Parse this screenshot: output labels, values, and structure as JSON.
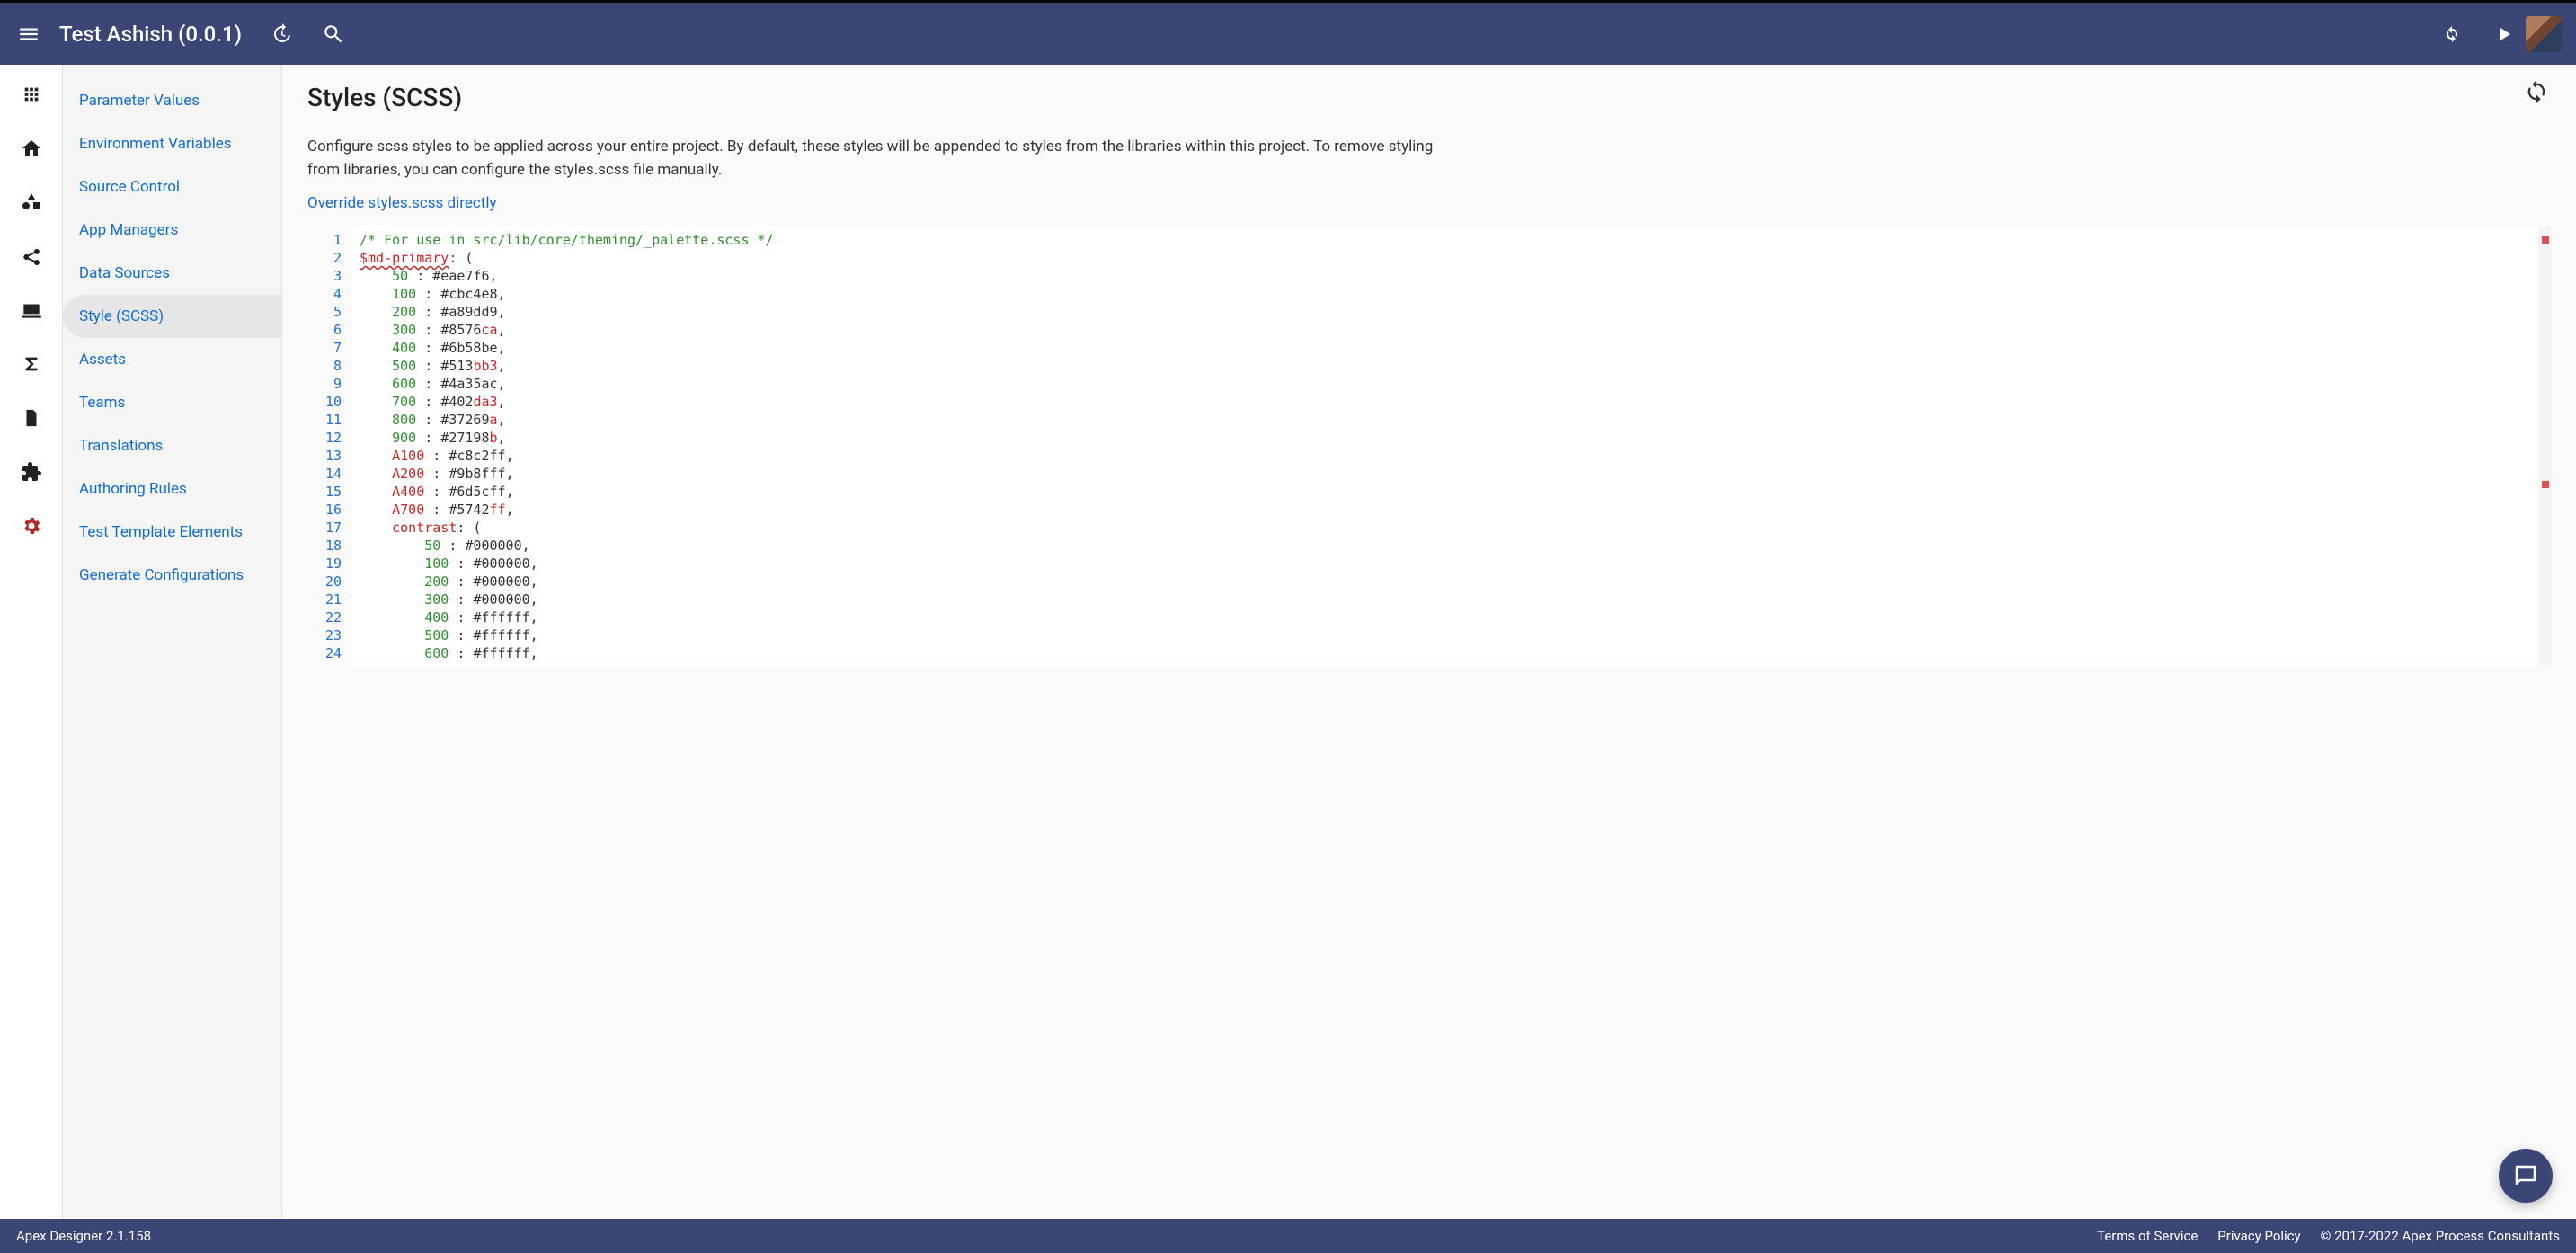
{
  "header": {
    "title": "Test Ashish (0.0.1)"
  },
  "rail": [
    {
      "name": "apps-icon"
    },
    {
      "name": "home-icon"
    },
    {
      "name": "shapes-icon"
    },
    {
      "name": "share-icon"
    },
    {
      "name": "laptop-icon"
    },
    {
      "name": "sigma-icon"
    },
    {
      "name": "file-icon"
    },
    {
      "name": "extension-icon"
    },
    {
      "name": "settings-icon"
    }
  ],
  "sidemenu": {
    "items": [
      {
        "label": "Parameter Values"
      },
      {
        "label": "Environment Variables"
      },
      {
        "label": "Source Control"
      },
      {
        "label": "App Managers"
      },
      {
        "label": "Data Sources"
      },
      {
        "label": "Style (SCSS)",
        "active": true
      },
      {
        "label": "Assets"
      },
      {
        "label": "Teams"
      },
      {
        "label": "Translations"
      },
      {
        "label": "Authoring Rules"
      },
      {
        "label": "Test Template Elements"
      },
      {
        "label": "Generate Configurations"
      }
    ]
  },
  "content": {
    "title": "Styles (SCSS)",
    "desc": "Configure scss styles to be applied across your entire project. By default, these styles will be appended to styles from the libraries within this project. To remove styling from libraries, you can configure the styles.scss file manually.",
    "link": "Override styles.scss directly"
  },
  "code": {
    "lines": [
      {
        "n": 1,
        "segs": [
          {
            "t": "/* For use in src/lib/core/theming/_palette.scss */",
            "c": "c-comment"
          }
        ]
      },
      {
        "n": 2,
        "segs": [
          {
            "t": "$md-primary",
            "c": "c-var underline-red"
          },
          {
            "t": ":",
            "c": "c-var"
          },
          {
            "t": " (",
            "c": "c-text"
          }
        ]
      },
      {
        "n": 3,
        "segs": [
          {
            "t": "    50 ",
            "c": "c-num"
          },
          {
            "t": ": ",
            "c": "c-text"
          },
          {
            "t": "#eae7f6",
            "c": "c-hex"
          },
          {
            "t": ",",
            "c": "c-text"
          }
        ]
      },
      {
        "n": 4,
        "segs": [
          {
            "t": "    100 ",
            "c": "c-num"
          },
          {
            "t": ": ",
            "c": "c-text"
          },
          {
            "t": "#cbc4e8",
            "c": "c-hex"
          },
          {
            "t": ",",
            "c": "c-text"
          }
        ]
      },
      {
        "n": 5,
        "segs": [
          {
            "t": "    200 ",
            "c": "c-num"
          },
          {
            "t": ": ",
            "c": "c-text"
          },
          {
            "t": "#a89dd9",
            "c": "c-hex"
          },
          {
            "t": ",",
            "c": "c-text"
          }
        ]
      },
      {
        "n": 6,
        "segs": [
          {
            "t": "    300 ",
            "c": "c-num"
          },
          {
            "t": ": ",
            "c": "c-text"
          },
          {
            "t": "#8576",
            "c": "c-hex"
          },
          {
            "t": "ca",
            "c": "c-hexr"
          },
          {
            "t": ",",
            "c": "c-text"
          }
        ]
      },
      {
        "n": 7,
        "segs": [
          {
            "t": "    400 ",
            "c": "c-num"
          },
          {
            "t": ": ",
            "c": "c-text"
          },
          {
            "t": "#6b58be",
            "c": "c-hex"
          },
          {
            "t": ",",
            "c": "c-text"
          }
        ]
      },
      {
        "n": 8,
        "segs": [
          {
            "t": "    500 ",
            "c": "c-num"
          },
          {
            "t": ": ",
            "c": "c-text"
          },
          {
            "t": "#513",
            "c": "c-hex"
          },
          {
            "t": "bb3",
            "c": "c-hexr"
          },
          {
            "t": ",",
            "c": "c-text"
          }
        ]
      },
      {
        "n": 9,
        "segs": [
          {
            "t": "    600 ",
            "c": "c-num"
          },
          {
            "t": ": ",
            "c": "c-text"
          },
          {
            "t": "#4a35ac",
            "c": "c-hex"
          },
          {
            "t": ",",
            "c": "c-text"
          }
        ]
      },
      {
        "n": 10,
        "segs": [
          {
            "t": "    700 ",
            "c": "c-num"
          },
          {
            "t": ": ",
            "c": "c-text"
          },
          {
            "t": "#402",
            "c": "c-hex"
          },
          {
            "t": "da3",
            "c": "c-hexr"
          },
          {
            "t": ",",
            "c": "c-text"
          }
        ]
      },
      {
        "n": 11,
        "segs": [
          {
            "t": "    800 ",
            "c": "c-num"
          },
          {
            "t": ": ",
            "c": "c-text"
          },
          {
            "t": "#37269",
            "c": "c-hex"
          },
          {
            "t": "a",
            "c": "c-hexr"
          },
          {
            "t": ",",
            "c": "c-text"
          }
        ]
      },
      {
        "n": 12,
        "segs": [
          {
            "t": "    900 ",
            "c": "c-num"
          },
          {
            "t": ": ",
            "c": "c-text"
          },
          {
            "t": "#27198",
            "c": "c-hex"
          },
          {
            "t": "b",
            "c": "c-hexr"
          },
          {
            "t": ",",
            "c": "c-text"
          }
        ]
      },
      {
        "n": 13,
        "segs": [
          {
            "t": "    A100 ",
            "c": "c-key"
          },
          {
            "t": ": ",
            "c": "c-text"
          },
          {
            "t": "#c8c2ff",
            "c": "c-hex"
          },
          {
            "t": ",",
            "c": "c-text"
          }
        ]
      },
      {
        "n": 14,
        "segs": [
          {
            "t": "    A200 ",
            "c": "c-key"
          },
          {
            "t": ": ",
            "c": "c-text"
          },
          {
            "t": "#9b8fff",
            "c": "c-hex"
          },
          {
            "t": ",",
            "c": "c-text"
          }
        ]
      },
      {
        "n": 15,
        "segs": [
          {
            "t": "    A400 ",
            "c": "c-key"
          },
          {
            "t": ": ",
            "c": "c-text"
          },
          {
            "t": "#6d5cff",
            "c": "c-hex"
          },
          {
            "t": ",",
            "c": "c-text"
          }
        ]
      },
      {
        "n": 16,
        "segs": [
          {
            "t": "    A700 ",
            "c": "c-key"
          },
          {
            "t": ": ",
            "c": "c-text"
          },
          {
            "t": "#5742",
            "c": "c-hex"
          },
          {
            "t": "ff",
            "c": "c-hexr"
          },
          {
            "t": ",",
            "c": "c-text"
          }
        ]
      },
      {
        "n": 17,
        "segs": [
          {
            "t": "    contrast",
            "c": "c-key"
          },
          {
            "t": ": (",
            "c": "c-text"
          }
        ]
      },
      {
        "n": 18,
        "segs": [
          {
            "t": "        50 ",
            "c": "c-num"
          },
          {
            "t": ": ",
            "c": "c-text"
          },
          {
            "t": "#000000",
            "c": "c-hex"
          },
          {
            "t": ",",
            "c": "c-text"
          }
        ]
      },
      {
        "n": 19,
        "segs": [
          {
            "t": "        100 ",
            "c": "c-num"
          },
          {
            "t": ": ",
            "c": "c-text"
          },
          {
            "t": "#000000",
            "c": "c-hex"
          },
          {
            "t": ",",
            "c": "c-text"
          }
        ]
      },
      {
        "n": 20,
        "segs": [
          {
            "t": "        200 ",
            "c": "c-num"
          },
          {
            "t": ": ",
            "c": "c-text"
          },
          {
            "t": "#000000",
            "c": "c-hex"
          },
          {
            "t": ",",
            "c": "c-text"
          }
        ]
      },
      {
        "n": 21,
        "segs": [
          {
            "t": "        300 ",
            "c": "c-num"
          },
          {
            "t": ": ",
            "c": "c-text"
          },
          {
            "t": "#000000",
            "c": "c-hex"
          },
          {
            "t": ",",
            "c": "c-text"
          }
        ]
      },
      {
        "n": 22,
        "segs": [
          {
            "t": "        400 ",
            "c": "c-num"
          },
          {
            "t": ": ",
            "c": "c-text"
          },
          {
            "t": "#ffffff",
            "c": "c-hex"
          },
          {
            "t": ",",
            "c": "c-text"
          }
        ]
      },
      {
        "n": 23,
        "segs": [
          {
            "t": "        500 ",
            "c": "c-num"
          },
          {
            "t": ": ",
            "c": "c-text"
          },
          {
            "t": "#ffffff",
            "c": "c-hex"
          },
          {
            "t": ",",
            "c": "c-text"
          }
        ]
      },
      {
        "n": 24,
        "segs": [
          {
            "t": "        600 ",
            "c": "c-num"
          },
          {
            "t": ": ",
            "c": "c-text"
          },
          {
            "t": "#ffffff",
            "c": "c-hex"
          },
          {
            "t": ",",
            "c": "c-text"
          }
        ]
      }
    ]
  },
  "footer": {
    "version": "Apex Designer 2.1.158",
    "tos": "Terms of Service",
    "privacy": "Privacy Policy",
    "copyright": "© 2017-2022 Apex Process Consultants"
  }
}
